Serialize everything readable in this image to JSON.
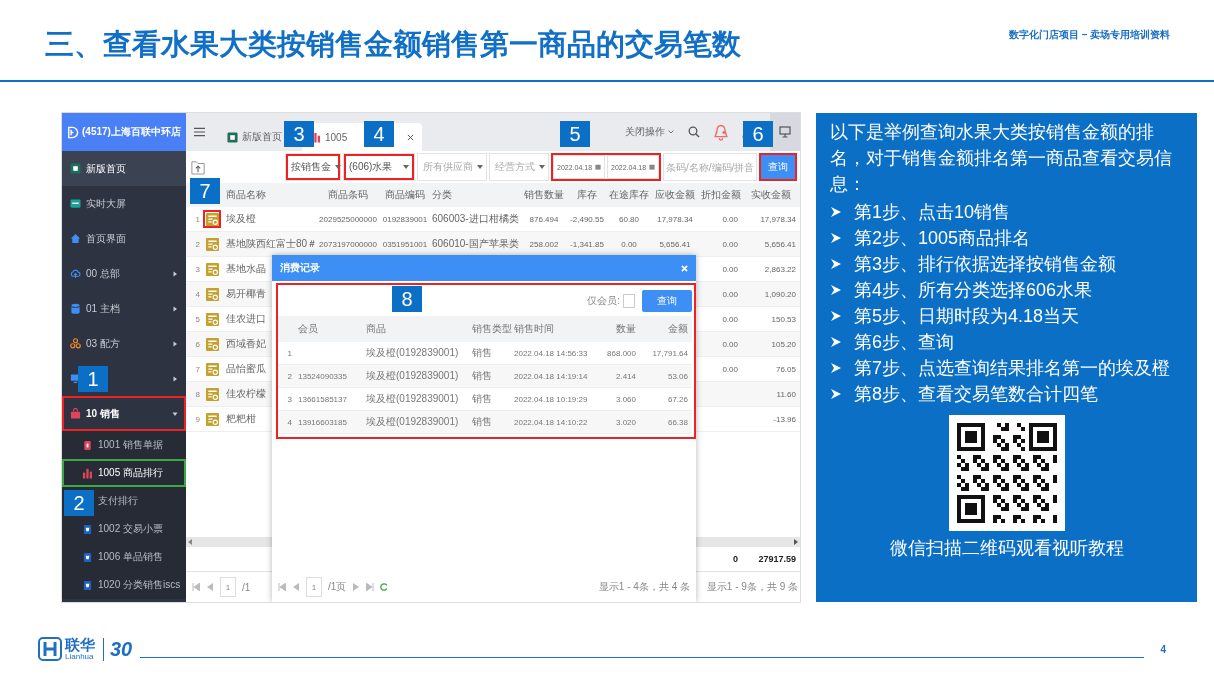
{
  "header": {
    "title": "三、查看水果大类按销售金额销售第一商品的交易笔数",
    "subtitle": "数字化门店项目 – 卖场专用培训资料"
  },
  "app": {
    "sidebar": {
      "store": "(4517)上海百联中环店",
      "items": [
        {
          "label": "新版首页",
          "kind": "page",
          "selected": true
        },
        {
          "label": "实时大屏",
          "kind": "page",
          "selected": false
        },
        {
          "label": "首页界面",
          "kind": "page",
          "selected": false
        },
        {
          "label": "00 总部",
          "kind": "group",
          "selected": false,
          "expanded": false
        },
        {
          "label": "01 主档",
          "kind": "group",
          "selected": false,
          "expanded": false
        },
        {
          "label": "03 配方",
          "kind": "group",
          "selected": false,
          "expanded": false
        },
        {
          "kind": "group",
          "selected": false,
          "expanded": false
        },
        {
          "label": "10 销售",
          "kind": "group",
          "selected": false,
          "expanded": true,
          "highlighted": true,
          "children": [
            {
              "label": "1001 销售单据",
              "selected": false
            },
            {
              "label": "1005 商品排行",
              "selected": true,
              "highlighted": true
            },
            {
              "label": "支付排行",
              "selected": false
            },
            {
              "label": "1002 交易小票",
              "selected": false
            },
            {
              "label": "1006 单品销售",
              "selected": false
            },
            {
              "label": "1020 分类销售iscs",
              "selected": false
            }
          ]
        }
      ]
    },
    "tabs": [
      {
        "label": "新版首页",
        "selected": false
      },
      {
        "label": "1005",
        "selected": true
      }
    ],
    "close_ops": "关闭操作",
    "filters": [
      {
        "text": "按销售金",
        "kind": "value",
        "highlighted": true
      },
      {
        "text": "(606)水果",
        "kind": "value",
        "highlighted": true
      },
      {
        "text": "所有供应商",
        "kind": "placeholder"
      },
      {
        "text": "经营方式",
        "kind": "placeholder"
      }
    ],
    "dates": {
      "from": "2022.04.18",
      "to": "2022.04.18",
      "highlighted": true
    },
    "search": {
      "placeholder": "条码/名称/编码/拼音"
    },
    "query": {
      "label": "查询",
      "highlighted": true
    },
    "table": {
      "columns": [
        "商品名称",
        "商品条码",
        "商品编码",
        "分类",
        "销售数量",
        "库存",
        "在途库存",
        "应收金额",
        "折扣金额",
        "实收金额"
      ],
      "rows": [
        {
          "index": "1",
          "highlighted": true,
          "cells": [
            "埃及橙",
            "2029525000000",
            "0192839001",
            "606003-进口柑橘类",
            "876.494",
            "-2,490.55",
            "60.80",
            "17,978.34",
            "0.00",
            "17,978.34"
          ]
        },
        {
          "index": "2",
          "cells": [
            "基地陕西红富士80＃",
            "2073197000000",
            "0351951001",
            "606010-国产苹果类",
            "258.002",
            "-1,341.85",
            "0.00",
            "5,656.41",
            "0.00",
            "5,656.41"
          ]
        },
        {
          "index": "3",
          "cells": [
            "基地水晶",
            null,
            null,
            null,
            null,
            null,
            null,
            null,
            "0.00",
            "2,863.22"
          ]
        },
        {
          "index": "4",
          "cells": [
            "易开椰青",
            null,
            null,
            null,
            null,
            null,
            null,
            null,
            "0.00",
            "1,090.20"
          ]
        },
        {
          "index": "5",
          "cells": [
            "佳农进口",
            null,
            null,
            null,
            null,
            null,
            null,
            null,
            "0.00",
            "150.53"
          ]
        },
        {
          "index": "6",
          "cells": [
            "西域香妃",
            null,
            null,
            null,
            null,
            null,
            null,
            null,
            "0.00",
            "105.20"
          ]
        },
        {
          "index": "7",
          "cells": [
            "品怡蜜瓜",
            null,
            null,
            null,
            null,
            null,
            null,
            null,
            "0.00",
            "76.05"
          ]
        },
        {
          "index": "8",
          "cells": [
            "佳农柠檬",
            null,
            null,
            null,
            null,
            null,
            null,
            null,
            null,
            "11.60"
          ]
        },
        {
          "index": "9",
          "cells": [
            "粑粑柑",
            null,
            null,
            null,
            null,
            null,
            null,
            null,
            null,
            "-13.96"
          ]
        }
      ],
      "totals": [
        "0",
        "27917.59"
      ],
      "pager": {
        "page": "1",
        "pages": "/1",
        "summary": "显示1 - 9条，共 9 条"
      }
    },
    "dialog": {
      "title": "消费记录",
      "member_only": {
        "label": "仅会员:",
        "checked": false
      },
      "query": "查询",
      "highlighted": true,
      "columns": [
        "会员",
        "商品",
        "销售类型",
        "销售时间",
        "数量",
        "金额"
      ],
      "rows": [
        {
          "index": "1",
          "cells": [
            null,
            "埃及橙(0192839001)",
            "销售",
            "2022.04.18 14:56:33",
            "868.000",
            "17,791.64"
          ]
        },
        {
          "index": "2",
          "cells": [
            "13524090335",
            "埃及橙(0192839001)",
            "销售",
            "2022.04.18 14:19:14",
            "2.414",
            "53.06"
          ]
        },
        {
          "index": "3",
          "cells": [
            "13661585137",
            "埃及橙(0192839001)",
            "销售",
            "2022.04.18 10:19:29",
            "3.060",
            "67.26"
          ]
        },
        {
          "index": "4",
          "cells": [
            "13916603185",
            "埃及橙(0192839001)",
            "销售",
            "2022.04.18 14:10:22",
            "3.020",
            "66.38"
          ]
        }
      ],
      "pager": {
        "page": "1",
        "pages": "/1页",
        "summary": "显示1 - 4条，共 4 条"
      }
    },
    "callouts": [
      "1",
      "2",
      "3",
      "4",
      "5",
      "6",
      "7",
      "8"
    ]
  },
  "panel": {
    "intro": "以下是举例查询水果大类按销售金额的排名，对于销售金额排名第一商品查看交易信息：",
    "steps": [
      "第1步、点击10销售",
      "第2步、1005商品排名",
      "第3步、排行依据选择按销售金额",
      "第4步、所有分类选择606水果",
      "第5步、日期时段为4.18当天",
      "第6步、查询",
      "第7步、点选查询结果排名第一的埃及橙",
      "第8步、查看交易笔数合计四笔"
    ],
    "qr_caption": "微信扫描二维码观看视听教程"
  },
  "footer": {
    "brand": "联华",
    "brand_latin": "Lianhua",
    "anniversary": "30",
    "page": "4"
  }
}
